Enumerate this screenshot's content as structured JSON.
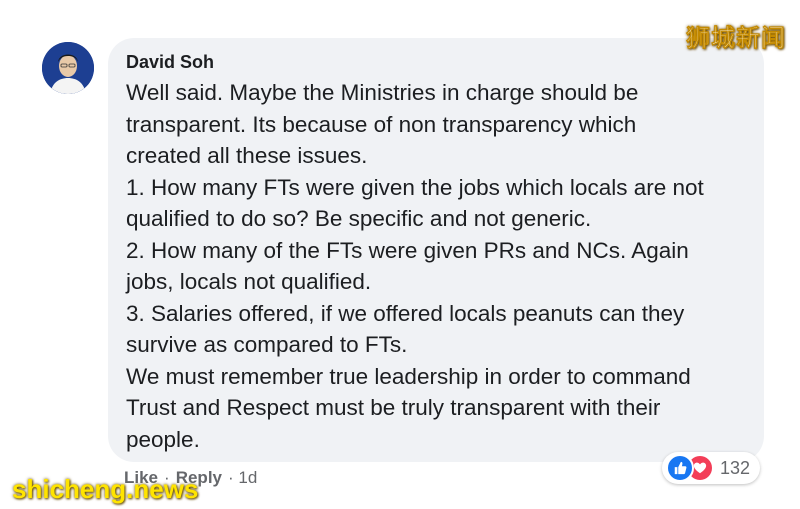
{
  "comment": {
    "author": "David Soh",
    "lines": [
      "Well said. Maybe the Ministries in charge should be",
      "transparent. Its because of non transparency which",
      "created all these issues.",
      "1. How many FTs were given the jobs which locals are not",
      "qualified to do so? Be specific and not generic.",
      "2. How many of the FTs were given PRs and NCs. Again",
      "jobs, locals not qualified.",
      "3. Salaries offered, if we offered locals peanuts can they",
      "survive as compared to FTs.",
      "We must remember true leadership in order to command",
      "Trust and Respect must be truly transparent with their",
      "people."
    ],
    "actions": {
      "like_label": "Like",
      "separator": "·",
      "reply_label": "Reply",
      "time": "· 1d"
    },
    "reactions": {
      "icons": [
        "like-icon",
        "love-icon"
      ],
      "count": "132"
    }
  },
  "watermarks": {
    "top_right": "狮城新闻",
    "bottom_left": "shicheng.news"
  },
  "colors": {
    "bubble": "#f0f2f5",
    "text": "#1c1e21",
    "meta": "#65676b",
    "like": "#1877f2",
    "love": "#f33e58"
  }
}
